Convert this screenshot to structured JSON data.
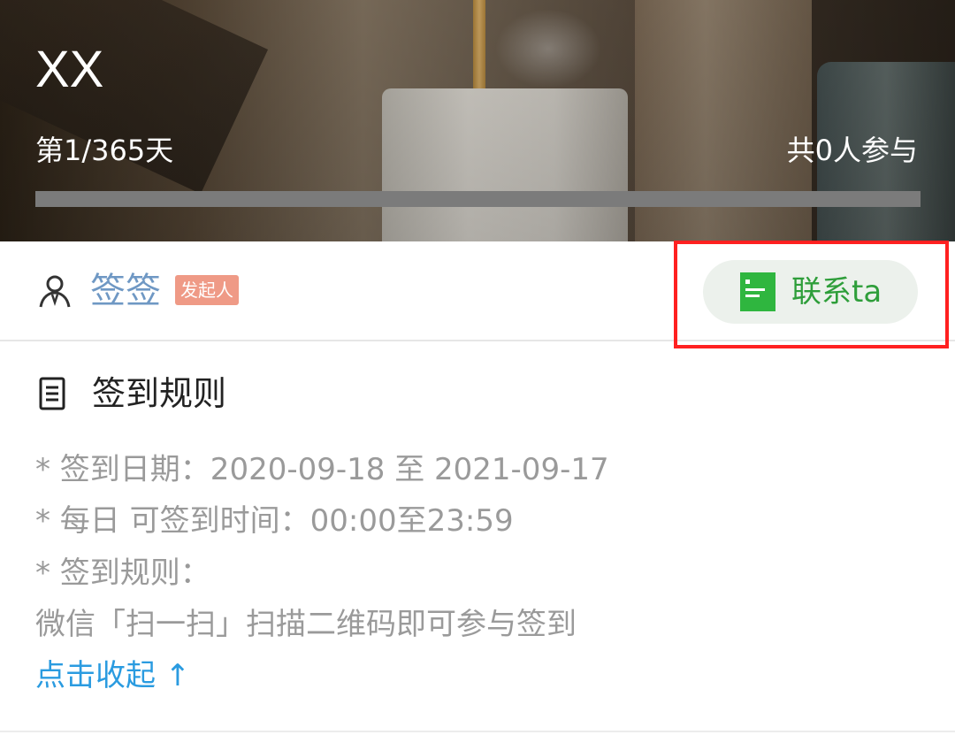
{
  "header": {
    "title": "XX",
    "day_progress": "第1/365天",
    "participants": "共0人参与",
    "progress_fraction": 0
  },
  "owner": {
    "name": "签签",
    "role_badge": "发起人",
    "contact_label": "联系ta"
  },
  "rules": {
    "heading": "签到规则",
    "lines": [
      "* 签到日期：2020-09-18 至 2021-09-17",
      "* 每日 可签到时间：00:00至23:59",
      "* 签到规则：",
      "微信「扫一扫」扫描二维码即可参与签到"
    ],
    "collapse_label": "点击收起 ↑"
  },
  "colors": {
    "owner_name": "#6f98c4",
    "badge_bg": "#ef9a86",
    "contact_text": "#2e9e3a",
    "contact_bg": "#ecf1ec",
    "link": "#2a9be0",
    "highlight_border": "#ff2020"
  },
  "icons": {
    "owner": "person-icon",
    "contact": "document-icon",
    "rules": "list-doc-icon"
  }
}
